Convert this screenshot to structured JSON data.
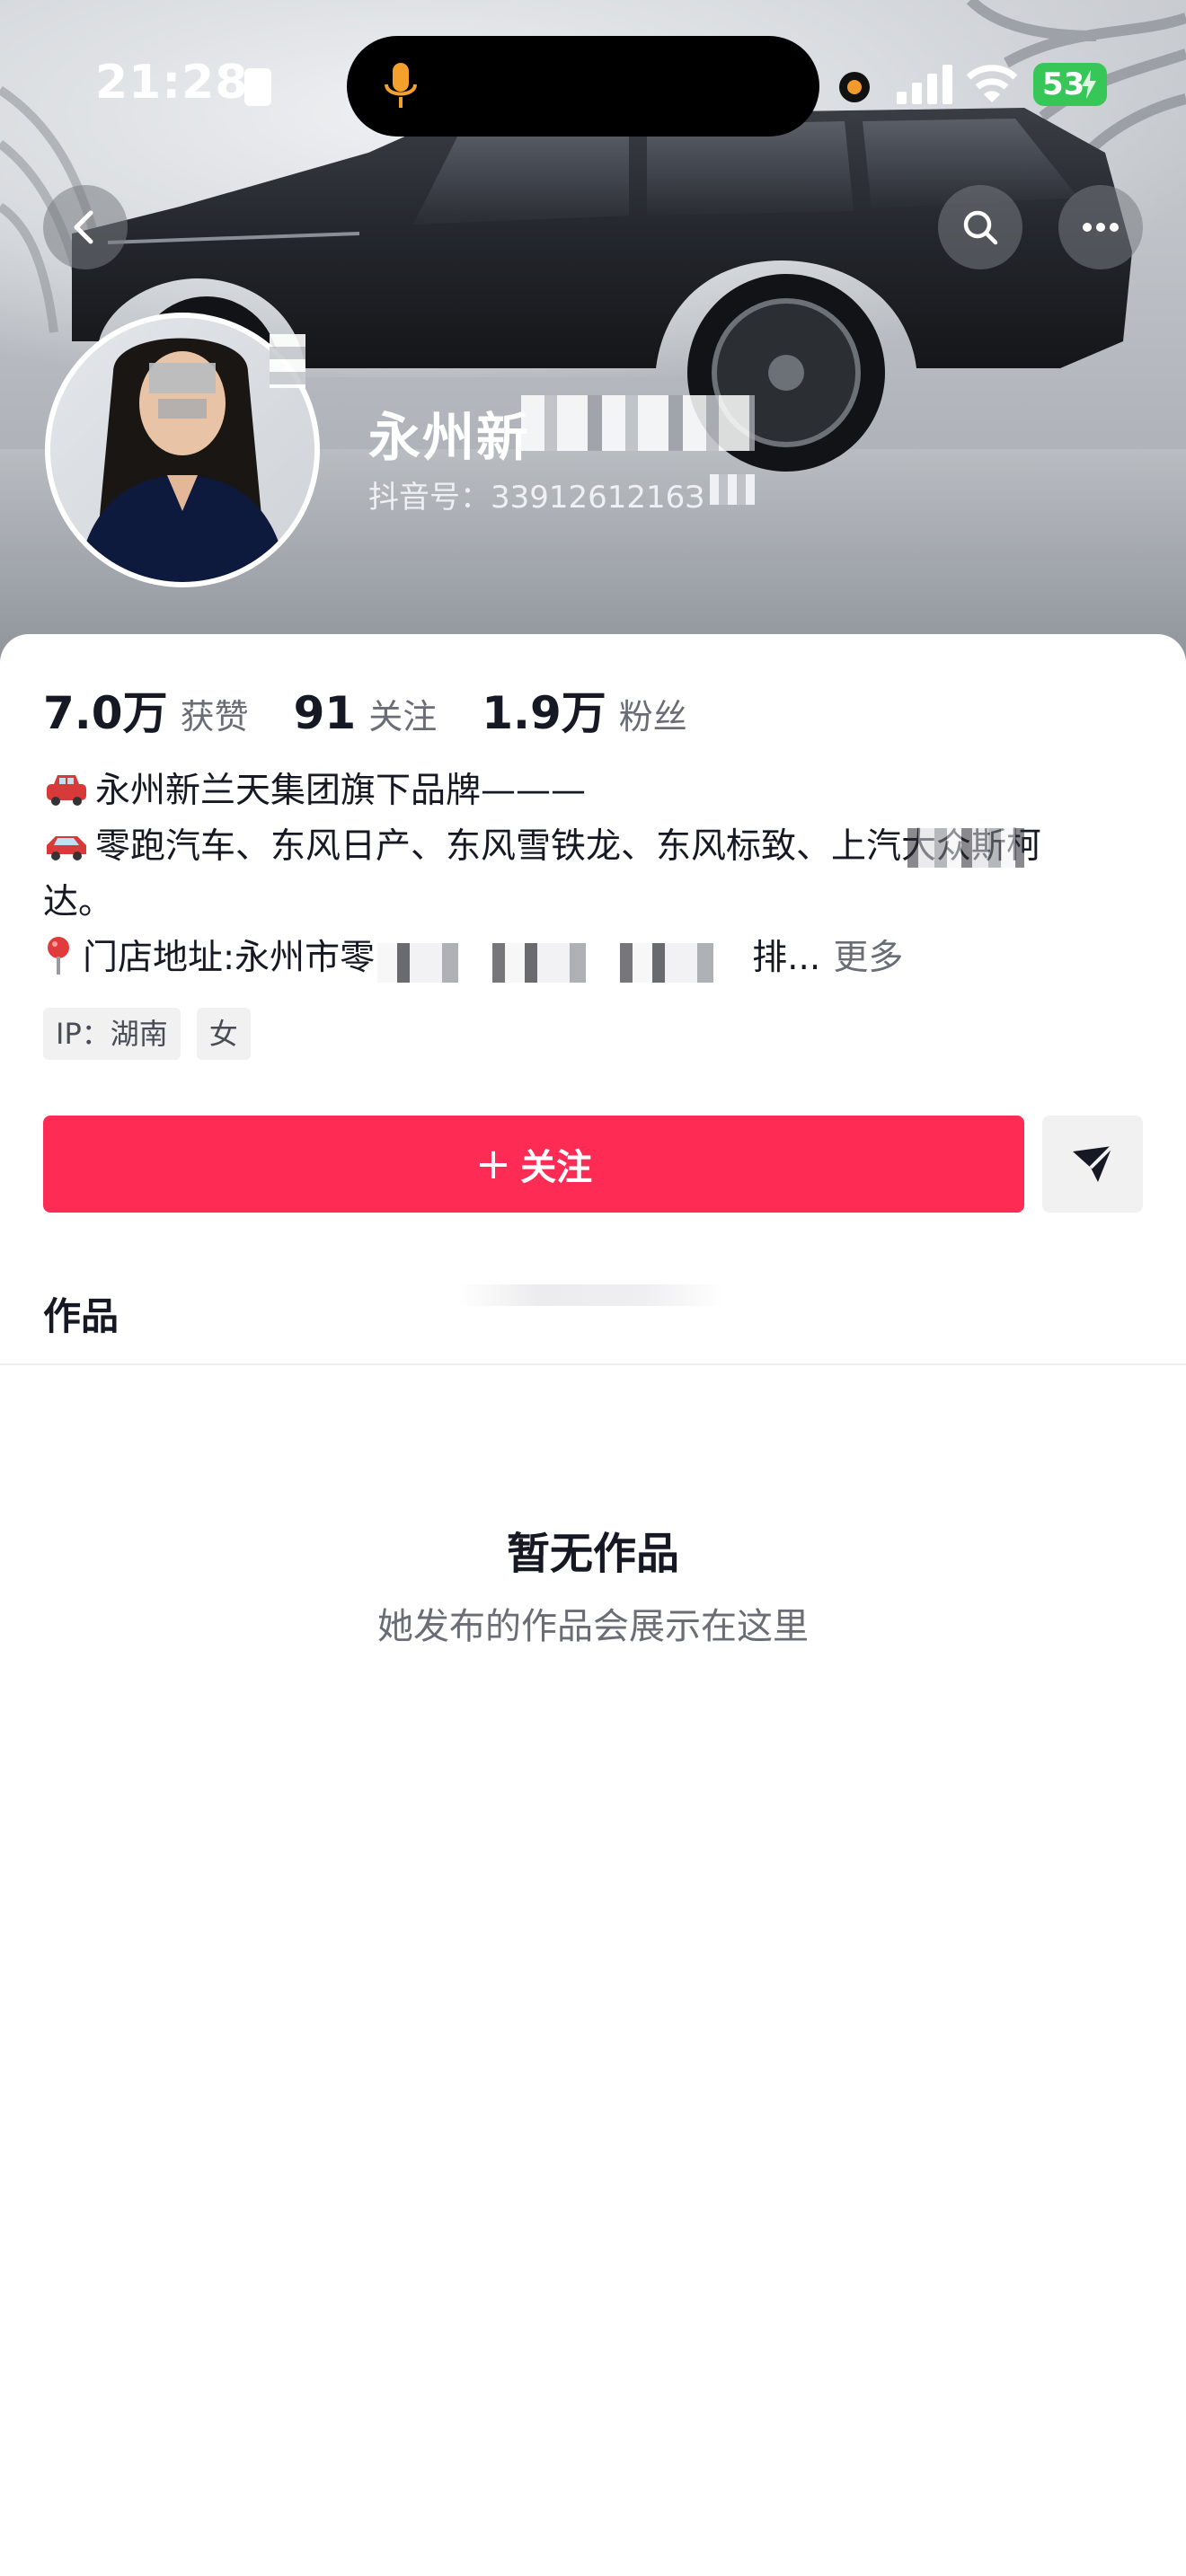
{
  "status_bar": {
    "time": "21:28",
    "battery": "53"
  },
  "profile": {
    "name_visible": "永州新",
    "douyin_id_label": "抖音号：",
    "douyin_id_value": "3391261216З"
  },
  "stats": [
    {
      "value": "7.0万",
      "label": "获赞"
    },
    {
      "value": "91",
      "label": "关注"
    },
    {
      "value": "1.9万",
      "label": "粉丝"
    }
  ],
  "bio": {
    "line1": "永州新兰天集团旗下品牌———",
    "line2": "零跑汽车、东风日产、东风雪铁龙、东风标致、上汽大众斯柯",
    "line3": "达。",
    "line4_prefix": "门店地址:永州市零",
    "line4_suffix": "排...",
    "more": "更多"
  },
  "tags": [
    "IP：湖南",
    "女"
  ],
  "actions": {
    "follow_label": "关注"
  },
  "tabs": {
    "works": "作品"
  },
  "empty_state": {
    "title": "暂无作品",
    "subtitle": "她发布的作品会展示在这里"
  },
  "colors": {
    "accent": "#fe2c55",
    "battery": "#37c759"
  },
  "icons": [
    "back-icon",
    "search-icon",
    "more-icon",
    "share-icon",
    "mic-icon",
    "wifi-icon",
    "signal-icon",
    "car-emoji-icon",
    "pin-emoji-icon"
  ]
}
